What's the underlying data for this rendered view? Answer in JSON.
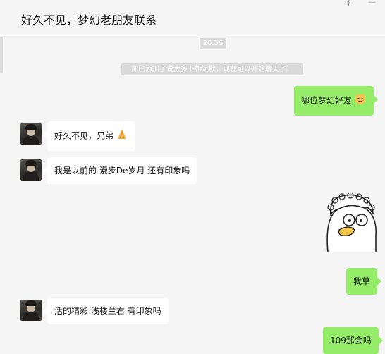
{
  "window": {
    "title": "好久不见，梦幻老朋友联系",
    "pin_glyph": "⇞",
    "minimize_glyph": "—"
  },
  "chat": {
    "timestamp": "20:56",
    "system_notice": "你已添加了说太多卜如沉默，现在可以开始聊天了。",
    "messages": [
      {
        "side": "right",
        "text": "哪位梦幻好友",
        "emoji": "cat-face"
      },
      {
        "side": "left",
        "text": "好久不见，兄弟",
        "emoji": "pinched-fingers"
      },
      {
        "side": "left",
        "text": "我是以前的 漫步De岁月 还有印象吗"
      },
      {
        "side": "right",
        "type": "sticker",
        "sticker": "duck-with-glasses"
      },
      {
        "side": "right",
        "text": "我草"
      },
      {
        "side": "left",
        "text": "活的精彩  浅楼兰君  有印象吗"
      },
      {
        "side": "right",
        "text": "109那会吗"
      }
    ]
  },
  "colors": {
    "background": "#f5f5f5",
    "outgoing_bubble": "#95ec69",
    "incoming_bubble": "#ffffff",
    "system_tag": "#dadada"
  }
}
